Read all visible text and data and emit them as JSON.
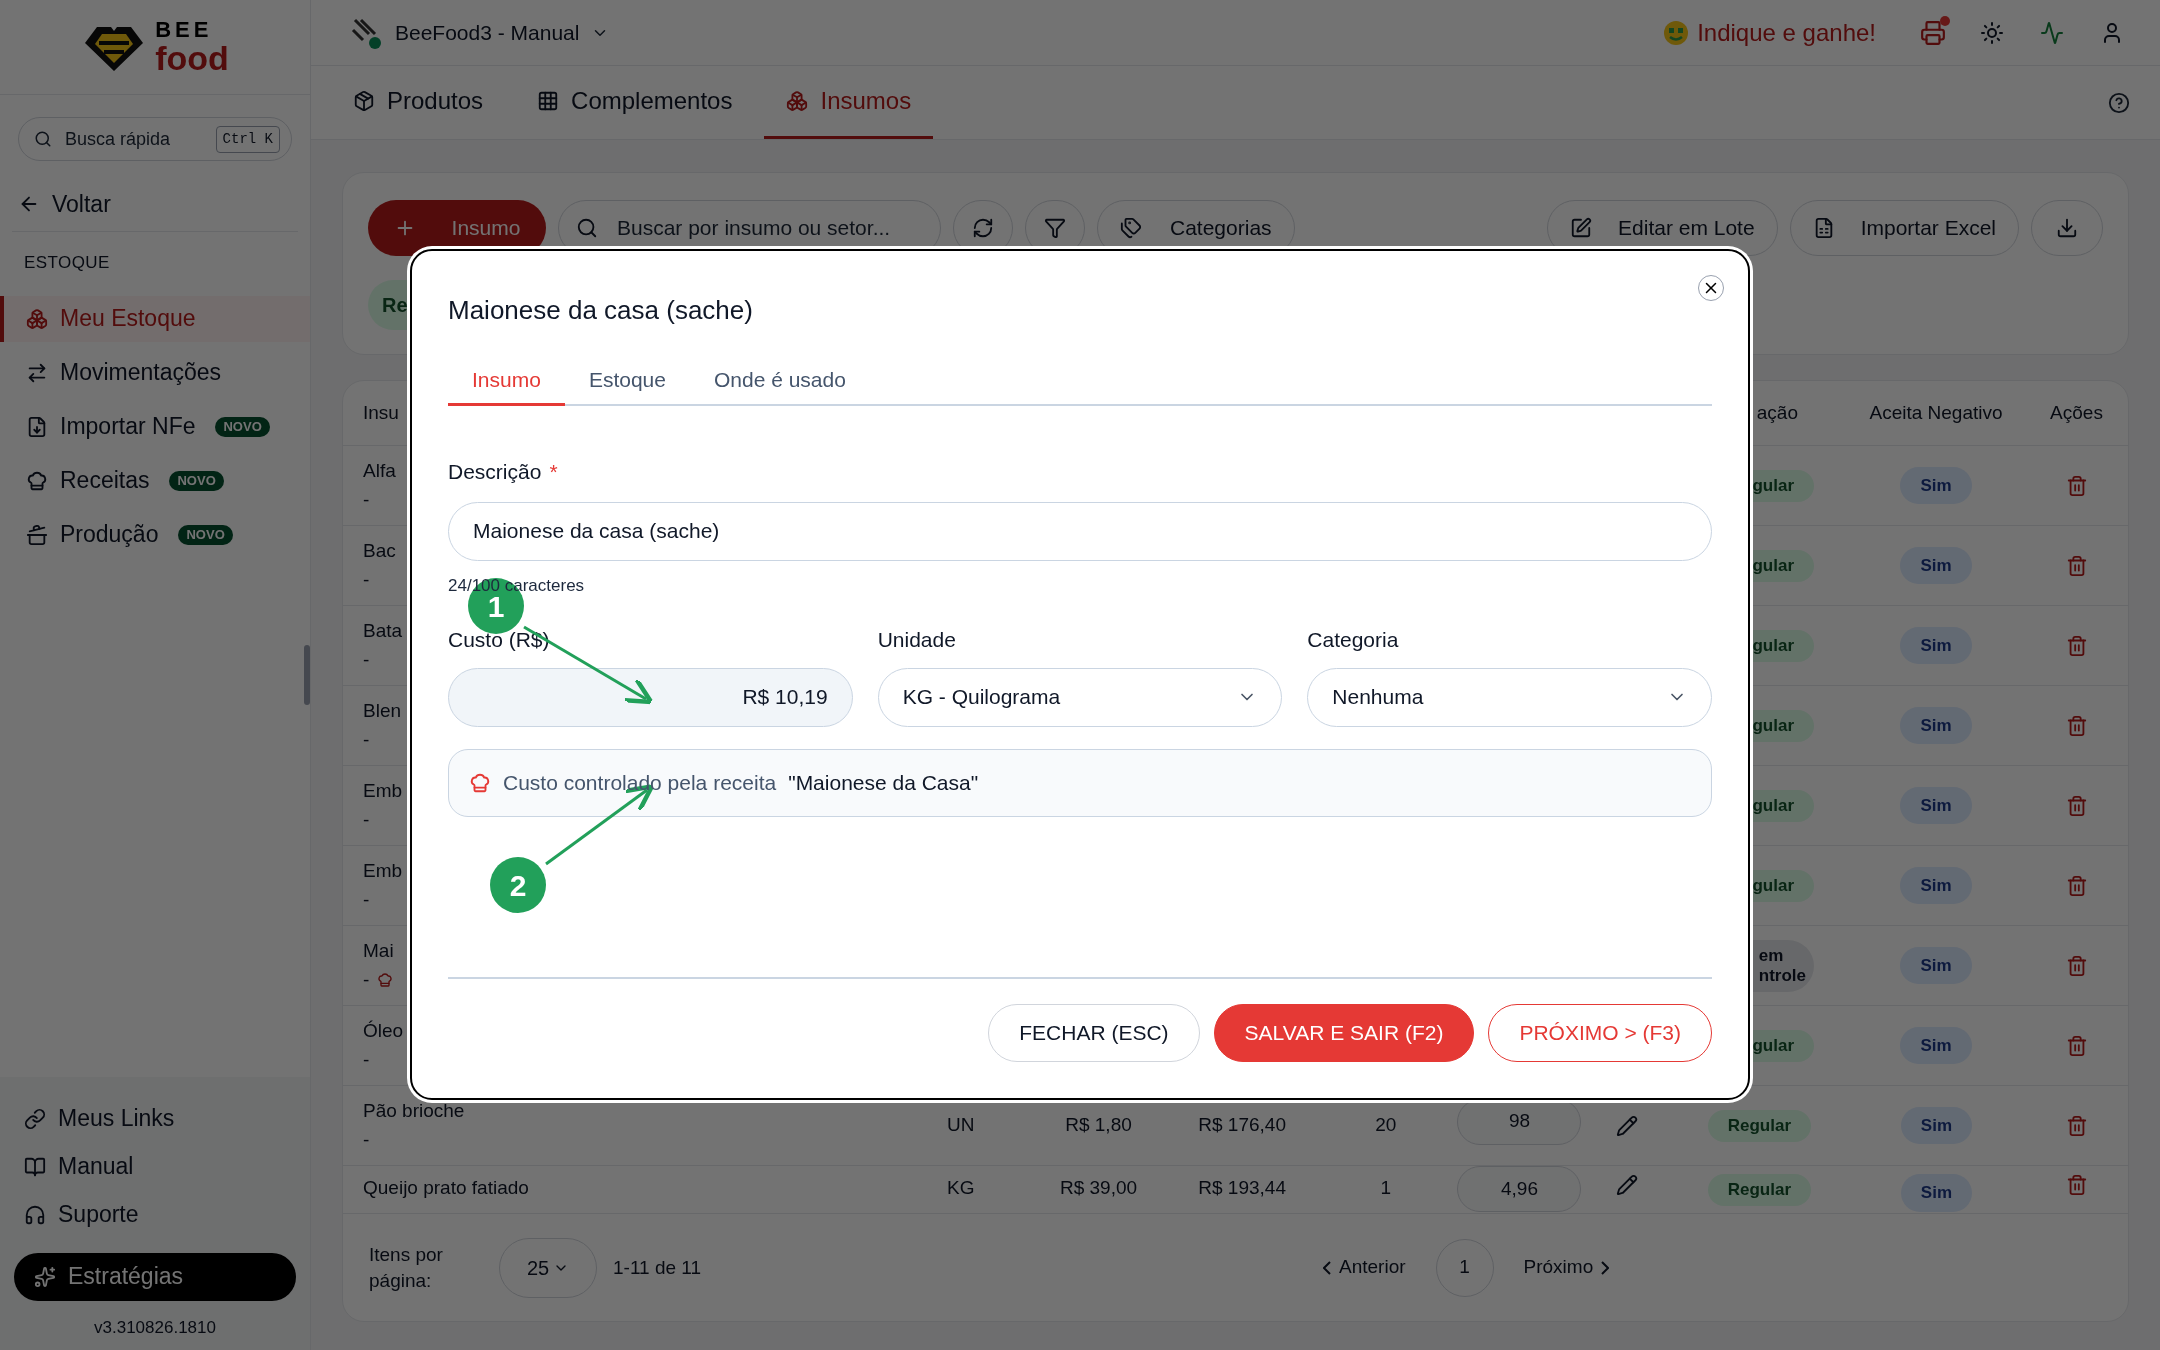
{
  "sidebar": {
    "logo": {
      "line1": "BEE",
      "line2": "food"
    },
    "search": {
      "placeholder": "Busca rápida",
      "shortcut": "Ctrl K"
    },
    "back": "Voltar",
    "section": "ESTOQUE",
    "items": [
      {
        "label": "Meu Estoque",
        "selected": true
      },
      {
        "label": "Movimentações",
        "selected": false
      },
      {
        "label": "Importar NFe",
        "selected": false,
        "badge": "NOVO"
      },
      {
        "label": "Receitas",
        "selected": false,
        "badge": "NOVO"
      },
      {
        "label": "Produção",
        "selected": false,
        "badge": "NOVO"
      }
    ],
    "footer_links": [
      {
        "label": "Meus Links"
      },
      {
        "label": "Manual"
      },
      {
        "label": "Suporte"
      }
    ],
    "cta": "Estratégias",
    "version": "v3.310826.1810"
  },
  "topbar": {
    "store": "BeeFood3 - Manual",
    "referral": "Indique e ganhe!",
    "notification": true
  },
  "tabs": [
    {
      "label": "Produtos",
      "selected": false
    },
    {
      "label": "Complementos",
      "selected": false
    },
    {
      "label": "Insumos",
      "selected": true
    }
  ],
  "toolbar": {
    "add": "Insumo",
    "search_placeholder": "Buscar por insumo ou setor...",
    "categories": "Categorias",
    "bulk_edit": "Editar em Lote",
    "import": "Importar Excel",
    "chip": "Re"
  },
  "table": {
    "columns": [
      {
        "label": "Insu"
      },
      {
        "label": "ação"
      },
      {
        "label": "Aceita Negativo"
      },
      {
        "label": "Ações"
      }
    ],
    "rows": [
      {
        "kind": "partial",
        "name": "Alfa",
        "sub": "-",
        "status": [
          "gular"
        ],
        "negative": "Sim"
      },
      {
        "kind": "partial",
        "name": "Bac",
        "sub": "-",
        "status": [
          "gular"
        ],
        "negative": "Sim"
      },
      {
        "kind": "partial",
        "name": "Bata",
        "sub": "-",
        "status": [
          "gular"
        ],
        "negative": "Sim"
      },
      {
        "kind": "partial",
        "name": "Blen",
        "sub": "-",
        "status": [
          "gular"
        ],
        "negative": "Sim"
      },
      {
        "kind": "partial",
        "name": "Emb",
        "sub": "-",
        "status": [
          "gular"
        ],
        "negative": "Sim"
      },
      {
        "kind": "partial",
        "name": "Emb",
        "sub": "-",
        "status": [
          "gular"
        ],
        "negative": "Sim"
      },
      {
        "kind": "partial",
        "name": "Mai",
        "sub": "-",
        "recipe": true,
        "status": [
          "em",
          "ntrole"
        ],
        "negative": "Sim"
      },
      {
        "kind": "partial",
        "name": "Óleo",
        "sub": "-",
        "status": [
          "gular"
        ],
        "negative": "Sim"
      },
      {
        "kind": "full",
        "name": "Pão brioche",
        "sub": "-",
        "unit": "UN",
        "cost": "R$ 1,80",
        "total": "R$ 176,40",
        "min": "20",
        "qty": "98",
        "status": [
          "Regular"
        ],
        "negative": "Sim"
      },
      {
        "kind": "full",
        "name": "Queijo prato fatiado",
        "unit": "KG",
        "cost": "R$ 39,00",
        "total": "R$ 193,44",
        "min": "1",
        "qty": "4,96",
        "status": [
          "Regular"
        ],
        "negative": "Sim"
      }
    ]
  },
  "pagination": {
    "per_page_label": "Itens por página:",
    "per_page": "25",
    "range": "1-11 de 11",
    "prev": "Anterior",
    "page": "1",
    "next": "Próximo"
  },
  "modal": {
    "title": "Maionese da casa (sache)",
    "tabs": [
      {
        "label": "Insumo",
        "selected": true
      },
      {
        "label": "Estoque",
        "selected": false
      },
      {
        "label": "Onde é usado",
        "selected": false
      }
    ],
    "description_label": "Descrição",
    "required_mark": "*",
    "description": "Maionese da casa (sache)",
    "counter": "24/100 caracteres",
    "cost_label": "Custo (R$)",
    "cost": "R$ 10,19",
    "cost_disabled": true,
    "unit_label": "Unidade",
    "unit": "KG - Quilograma",
    "category_label": "Categoria",
    "category": "Nenhuma",
    "info": {
      "text": "Custo controlado pela receita",
      "recipe": "\"Maionese da Casa\""
    },
    "buttons": [
      {
        "label": "FECHAR (ESC)",
        "kind": "outline"
      },
      {
        "label": "SALVAR E SAIR (F2)",
        "kind": "primary"
      },
      {
        "label": "PRÓXIMO > (F3)",
        "kind": "danger-outline"
      }
    ]
  },
  "annotations": [
    {
      "number": "1"
    },
    {
      "number": "2"
    }
  ]
}
